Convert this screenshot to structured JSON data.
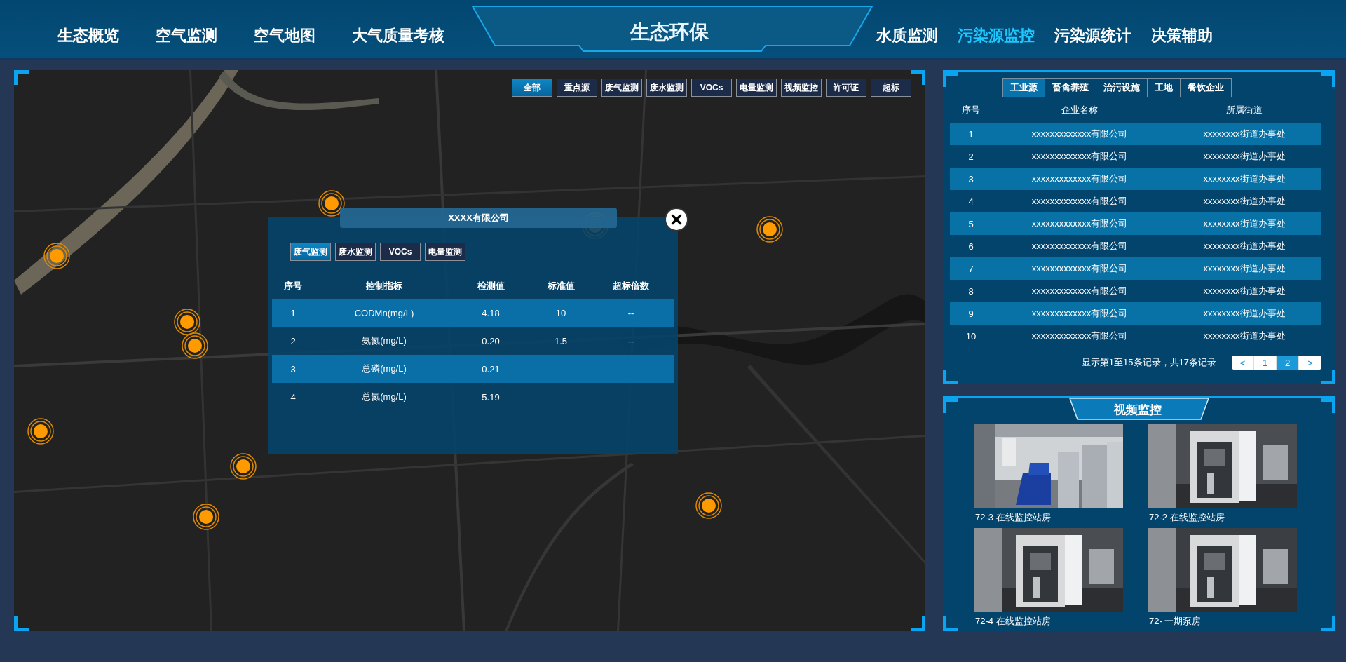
{
  "header": {
    "title": "生态环保",
    "nav_left": [
      {
        "label": "生态概览",
        "selected": false
      },
      {
        "label": "空气监测",
        "selected": false
      },
      {
        "label": "空气地图",
        "selected": false
      },
      {
        "label": "大气质量考核",
        "selected": false
      }
    ],
    "nav_right": [
      {
        "label": "水质监测",
        "selected": false
      },
      {
        "label": "污染源监控",
        "selected": true
      },
      {
        "label": "污染源统计",
        "selected": false
      },
      {
        "label": "决策辅助",
        "selected": false
      }
    ]
  },
  "map": {
    "filters": [
      {
        "label": "全部",
        "selected": true
      },
      {
        "label": "重点源",
        "selected": false
      },
      {
        "label": "废气监测",
        "selected": false
      },
      {
        "label": "废水监测",
        "selected": false
      },
      {
        "label": "VOCs",
        "selected": false
      },
      {
        "label": "电量监测",
        "selected": false
      },
      {
        "label": "视频监控",
        "selected": false
      },
      {
        "label": "许可证",
        "selected": false
      },
      {
        "label": "超标",
        "selected": false
      }
    ],
    "popup": {
      "title": "XXXX有限公司",
      "tabs": [
        {
          "label": "废气监测",
          "selected": true
        },
        {
          "label": "废水监测",
          "selected": false
        },
        {
          "label": "VOCs",
          "selected": false
        },
        {
          "label": "电量监测",
          "selected": false
        }
      ],
      "columns": [
        "序号",
        "控制指标",
        "检测值",
        "标准值",
        "超标倍数"
      ],
      "rows": [
        {
          "index": "1",
          "indicator": "CODMn(mg/L)",
          "measured": "4.18",
          "standard": "10",
          "ratio": "--"
        },
        {
          "index": "2",
          "indicator": "氨氮(mg/L)",
          "measured": "0.20",
          "standard": "1.5",
          "ratio": "--"
        },
        {
          "index": "3",
          "indicator": "总磷(mg/L)",
          "measured": "0.21"
        },
        {
          "index": "4",
          "indicator": "总氮(mg/L)",
          "measured": "5.19"
        }
      ]
    }
  },
  "sources": {
    "tabs": [
      {
        "label": "工业源",
        "selected": true
      },
      {
        "label": "畜禽养殖",
        "selected": false
      },
      {
        "label": "治污设施",
        "selected": false
      },
      {
        "label": "工地",
        "selected": false
      },
      {
        "label": "餐饮企业",
        "selected": false
      }
    ],
    "columns": [
      "序号",
      "企业名称",
      "所属街道"
    ],
    "rows": [
      [
        "1",
        "xxxxxxxxxxxxx有限公司",
        "xxxxxxxx街道办事处"
      ],
      [
        "2",
        "xxxxxxxxxxxxx有限公司",
        "xxxxxxxx街道办事处"
      ],
      [
        "3",
        "xxxxxxxxxxxxx有限公司",
        "xxxxxxxx街道办事处"
      ],
      [
        "4",
        "xxxxxxxxxxxxx有限公司",
        "xxxxxxxx街道办事处"
      ],
      [
        "5",
        "xxxxxxxxxxxxx有限公司",
        "xxxxxxxx街道办事处"
      ],
      [
        "6",
        "xxxxxxxxxxxxx有限公司",
        "xxxxxxxx街道办事处"
      ],
      [
        "7",
        "xxxxxxxxxxxxx有限公司",
        "xxxxxxxx街道办事处"
      ],
      [
        "8",
        "xxxxxxxxxxxxx有限公司",
        "xxxxxxxx街道办事处"
      ],
      [
        "9",
        "xxxxxxxxxxxxx有限公司",
        "xxxxxxxx街道办事处"
      ],
      [
        "10",
        "xxxxxxxxxxxxx有限公司",
        "xxxxxxxx街道办事处"
      ]
    ],
    "pagination": {
      "summary": "显示第1至15条记录，共17条记录",
      "prev": "<",
      "pages": [
        {
          "label": "1",
          "selected": false
        },
        {
          "label": "2",
          "selected": true
        }
      ],
      "next": ">"
    }
  },
  "video": {
    "title": "视频监控",
    "feeds": [
      {
        "caption": "72-3 在线监控站房",
        "kind": "picture"
      },
      {
        "caption": "72-2 在线监控站房",
        "kind": "picture"
      },
      {
        "caption": "72-4 在线监控站房",
        "kind": "picture"
      },
      {
        "caption": "72- 一期泵房",
        "kind": "picture"
      }
    ]
  }
}
